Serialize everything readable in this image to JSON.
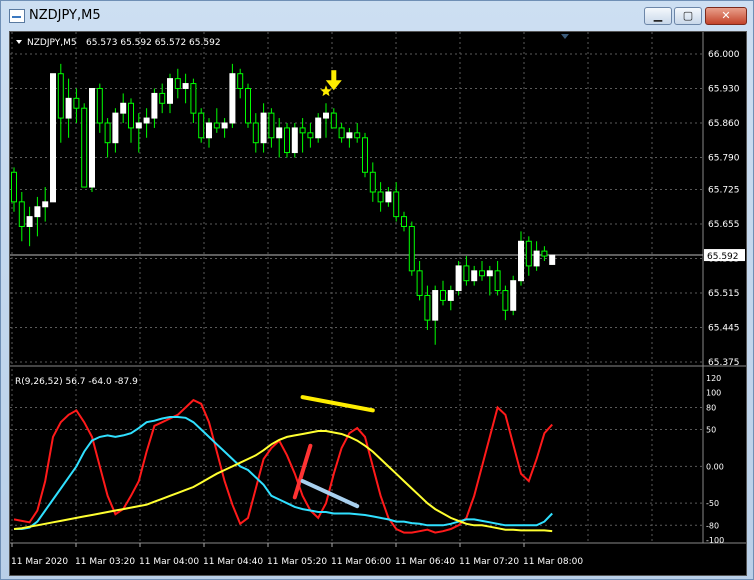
{
  "window": {
    "title": "NZDJPY,M5",
    "minimize_glyph": "▁",
    "maximize_glyph": "▢",
    "close_glyph": "✕"
  },
  "colors": {
    "background": "#000000",
    "grid": "#5a5a5a",
    "candle_up": "#ffffff",
    "candle_down": "#000000",
    "wick": "#00ff00",
    "axis_text": "#ffffff",
    "osc_red": "#ff1a1a",
    "osc_cyan": "#30e0ff",
    "osc_yellow": "#ffff30",
    "marker_yellow": "#ffee00",
    "bid_line": "#bbbbbb"
  },
  "main_header": {
    "symbol": "NZDJPY,M5",
    "ohlc": "65.573 65.592 65.572 65.592"
  },
  "osc_header": "R(9,26,52) 56.7 -64.0 -87.9",
  "chart_data": [
    {
      "type": "candlestick",
      "title": "",
      "price_ticks": [
        "66.000",
        "65.930",
        "65.860",
        "65.790",
        "65.725",
        "65.655",
        "65.585",
        "65.515",
        "65.445",
        "65.375"
      ],
      "ylim": [
        65.375,
        66.0
      ],
      "current_price": "65.592",
      "time_labels": [
        "11 Mar 2020",
        "11 Mar 03:20",
        "11 Mar 04:00",
        "11 Mar 04:40",
        "11 Mar 05:20",
        "11 Mar 06:00",
        "11 Mar 06:40",
        "11 Mar 07:20",
        "11 Mar 08:00"
      ],
      "markers": [
        {
          "icon": "down-arrow-icon",
          "index": 41
        },
        {
          "icon": "star-icon",
          "index": 40
        }
      ],
      "candles": [
        [
          65.76,
          65.77,
          65.68,
          65.7
        ],
        [
          65.7,
          65.72,
          65.62,
          65.65
        ],
        [
          65.65,
          65.69,
          65.61,
          65.67
        ],
        [
          65.67,
          65.71,
          65.63,
          65.69
        ],
        [
          65.69,
          65.73,
          65.66,
          65.7
        ],
        [
          65.7,
          65.96,
          65.7,
          65.96
        ],
        [
          65.96,
          65.98,
          65.82,
          65.87
        ],
        [
          65.87,
          65.95,
          65.83,
          65.91
        ],
        [
          65.91,
          65.93,
          65.86,
          65.89
        ],
        [
          65.89,
          65.9,
          65.73,
          65.73
        ],
        [
          65.73,
          65.93,
          65.72,
          65.93
        ],
        [
          65.93,
          65.94,
          65.84,
          65.86
        ],
        [
          65.86,
          65.87,
          65.79,
          65.82
        ],
        [
          65.82,
          65.89,
          65.8,
          65.88
        ],
        [
          65.88,
          65.92,
          65.86,
          65.9
        ],
        [
          65.9,
          65.91,
          65.82,
          65.85
        ],
        [
          65.85,
          65.88,
          65.8,
          65.86
        ],
        [
          65.86,
          65.89,
          65.83,
          65.87
        ],
        [
          65.87,
          65.93,
          65.85,
          65.92
        ],
        [
          65.92,
          65.94,
          65.88,
          65.9
        ],
        [
          65.9,
          65.96,
          65.88,
          65.95
        ],
        [
          65.95,
          65.97,
          65.91,
          65.93
        ],
        [
          65.93,
          65.96,
          65.9,
          65.94
        ],
        [
          65.94,
          65.95,
          65.86,
          65.88
        ],
        [
          65.88,
          65.89,
          65.82,
          65.83
        ],
        [
          65.83,
          65.87,
          65.81,
          65.86
        ],
        [
          65.86,
          65.89,
          65.84,
          65.85
        ],
        [
          65.85,
          65.87,
          65.83,
          65.86
        ],
        [
          65.86,
          65.98,
          65.85,
          65.96
        ],
        [
          65.96,
          65.97,
          65.91,
          65.93
        ],
        [
          65.93,
          65.94,
          65.85,
          65.86
        ],
        [
          65.86,
          65.88,
          65.8,
          65.82
        ],
        [
          65.82,
          65.9,
          65.8,
          65.88
        ],
        [
          65.88,
          65.89,
          65.81,
          65.83
        ],
        [
          65.83,
          65.87,
          65.79,
          65.85
        ],
        [
          65.85,
          65.86,
          65.79,
          65.8
        ],
        [
          65.8,
          65.86,
          65.79,
          65.85
        ],
        [
          65.85,
          65.87,
          65.8,
          65.84
        ],
        [
          65.84,
          65.86,
          65.81,
          65.83
        ],
        [
          65.83,
          65.88,
          65.82,
          65.87
        ],
        [
          65.87,
          65.9,
          65.83,
          65.88
        ],
        [
          65.88,
          65.89,
          65.85,
          65.85
        ],
        [
          65.85,
          65.86,
          65.82,
          65.83
        ],
        [
          65.83,
          65.85,
          65.81,
          65.84
        ],
        [
          65.84,
          65.86,
          65.82,
          65.83
        ],
        [
          65.83,
          65.84,
          65.75,
          65.76
        ],
        [
          65.76,
          65.78,
          65.7,
          65.72
        ],
        [
          65.72,
          65.74,
          65.68,
          65.7
        ],
        [
          65.7,
          65.73,
          65.69,
          65.72
        ],
        [
          65.72,
          65.74,
          65.66,
          65.67
        ],
        [
          65.67,
          65.68,
          65.64,
          65.65
        ],
        [
          65.65,
          65.66,
          65.55,
          65.56
        ],
        [
          65.56,
          65.58,
          65.5,
          65.51
        ],
        [
          65.51,
          65.53,
          65.44,
          65.46
        ],
        [
          65.46,
          65.53,
          65.41,
          65.52
        ],
        [
          65.52,
          65.54,
          65.49,
          65.5
        ],
        [
          65.5,
          65.53,
          65.48,
          65.52
        ],
        [
          65.52,
          65.58,
          65.51,
          65.57
        ],
        [
          65.57,
          65.59,
          65.53,
          65.54
        ],
        [
          65.54,
          65.57,
          65.53,
          65.56
        ],
        [
          65.56,
          65.58,
          65.54,
          65.55
        ],
        [
          65.55,
          65.57,
          65.51,
          65.56
        ],
        [
          65.56,
          65.58,
          65.51,
          65.52
        ],
        [
          65.52,
          65.53,
          65.46,
          65.48
        ],
        [
          65.48,
          65.55,
          65.47,
          65.54
        ],
        [
          65.54,
          65.64,
          65.53,
          65.62
        ],
        [
          65.62,
          65.63,
          65.55,
          65.57
        ],
        [
          65.57,
          65.62,
          65.56,
          65.6
        ],
        [
          65.6,
          65.61,
          65.58,
          65.59
        ],
        [
          65.573,
          65.592,
          65.572,
          65.592
        ]
      ]
    },
    {
      "type": "line",
      "title": "",
      "y_ticks": [
        "120",
        "100",
        "80",
        "50",
        "0.00",
        "-50",
        "-80",
        "-100"
      ],
      "ylim": [
        -100,
        120
      ],
      "series": [
        {
          "color": "#ff1a1a",
          "values": [
            -72,
            -74,
            -76,
            -60,
            -20,
            40,
            60,
            70,
            76,
            60,
            40,
            0,
            -40,
            -65,
            -58,
            -40,
            -20,
            20,
            55,
            60,
            65,
            70,
            80,
            90,
            85,
            60,
            20,
            -20,
            -52,
            -78,
            -70,
            -30,
            10,
            25,
            35,
            15,
            -10,
            -40,
            -60,
            -70,
            -50,
            -10,
            25,
            45,
            52,
            40,
            0,
            -40,
            -70,
            -85,
            -90,
            -90,
            -88,
            -86,
            -90,
            -88,
            -85,
            -80,
            -70,
            -40,
            0,
            40,
            80,
            70,
            30,
            -10,
            -20,
            10,
            45,
            56.7
          ]
        },
        {
          "color": "#30e0ff",
          "values": [
            -85,
            -85,
            -83,
            -75,
            -60,
            -45,
            -30,
            -15,
            0,
            20,
            35,
            40,
            42,
            40,
            42,
            45,
            52,
            60,
            62,
            65,
            67,
            67,
            66,
            60,
            50,
            40,
            30,
            20,
            10,
            0,
            -5,
            -15,
            -25,
            -40,
            -45,
            -50,
            -55,
            -58,
            -60,
            -62,
            -62,
            -64,
            -64,
            -64,
            -65,
            -66,
            -68,
            -70,
            -72,
            -75,
            -75,
            -77,
            -78,
            -80,
            -80,
            -80,
            -78,
            -75,
            -72,
            -72,
            -74,
            -76,
            -78,
            -80,
            -80,
            -80,
            -80,
            -80,
            -75,
            -64
          ]
        },
        {
          "color": "#ffff30",
          "values": [
            -85,
            -84,
            -82,
            -80,
            -78,
            -76,
            -74,
            -72,
            -70,
            -68,
            -66,
            -64,
            -62,
            -60,
            -58,
            -56,
            -54,
            -52,
            -48,
            -44,
            -40,
            -36,
            -32,
            -28,
            -22,
            -16,
            -10,
            -5,
            0,
            5,
            10,
            15,
            22,
            30,
            36,
            40,
            42,
            44,
            46,
            48,
            48,
            46,
            44,
            40,
            35,
            28,
            20,
            10,
            0,
            -10,
            -20,
            -30,
            -40,
            -50,
            -58,
            -64,
            -70,
            -74,
            -78,
            -80,
            -80,
            -82,
            -84,
            -86,
            -86,
            -87,
            -87,
            -87,
            -87,
            -87.9
          ]
        }
      ],
      "annotations": [
        {
          "color": "#ffee00",
          "from": [
            37,
            94
          ],
          "to": [
            46,
            76
          ]
        },
        {
          "color": "#ff3333",
          "from": [
            36,
            -42
          ],
          "to": [
            38,
            28
          ]
        },
        {
          "color": "#a8d0ee",
          "from": [
            37,
            -20
          ],
          "to": [
            44,
            -54
          ]
        }
      ]
    }
  ]
}
